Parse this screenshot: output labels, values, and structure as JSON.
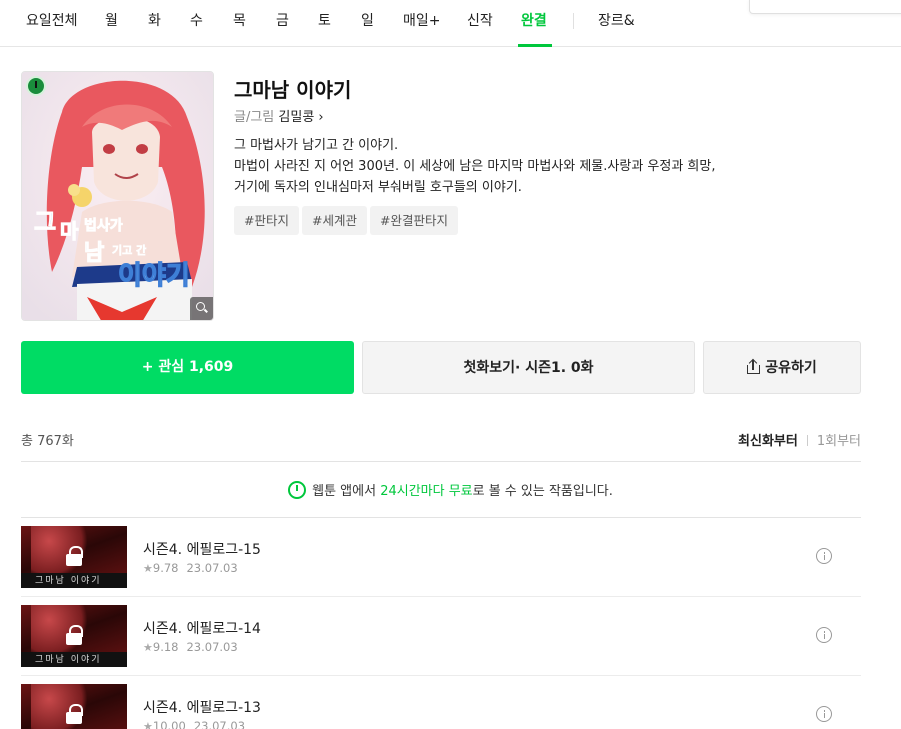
{
  "nav": {
    "tabs": [
      {
        "label": "요일전체"
      },
      {
        "label": "월"
      },
      {
        "label": "화"
      },
      {
        "label": "수"
      },
      {
        "label": "목"
      },
      {
        "label": "금"
      },
      {
        "label": "토"
      },
      {
        "label": "일"
      },
      {
        "label": "매일+"
      },
      {
        "label": "신작"
      },
      {
        "label": "완결",
        "active": true
      },
      {
        "label": "장르&"
      }
    ]
  },
  "webtoon": {
    "title": "그마남 이야기",
    "author_label": "글/그림",
    "author_name": "김밀콩 ›",
    "description": [
      "그 마법사가 남기고 간 이야기.",
      "마법이 사라진 지 어언 300년. 이 세상에 남은 마지막 마법사와 제물.사랑과 우정과 희망,",
      "거기에 독자의 인내심마저 부숴버릴 호구들의 이야기."
    ],
    "tags": [
      "#판타지",
      "#세계관",
      "#완결판타지"
    ]
  },
  "actions": {
    "favorite": "+ 관심 1,609",
    "first_episode": "첫화보기· 시즌1. 0화",
    "share": "공유하기"
  },
  "episodes_header": {
    "total": "총 767화",
    "sort_latest": "최신화부터",
    "sort_first": "1회부터"
  },
  "notice": {
    "prefix": "웹툰 앱에서 ",
    "highlight": "24시간마다 무료",
    "suffix": "로 볼 수 있는 작품입니다."
  },
  "thumb_caption": "그마남 이야기",
  "episodes": [
    {
      "title": "시즌4. 에필로그-15",
      "rating": "9.78",
      "date": "23.07.03"
    },
    {
      "title": "시즌4. 에필로그-14",
      "rating": "9.18",
      "date": "23.07.03"
    },
    {
      "title": "시즌4. 에필로그-13",
      "rating": "10.00",
      "date": "23.07.03"
    }
  ],
  "colors": {
    "accent": "#00c73c",
    "favorite_button": "#00dc64"
  }
}
